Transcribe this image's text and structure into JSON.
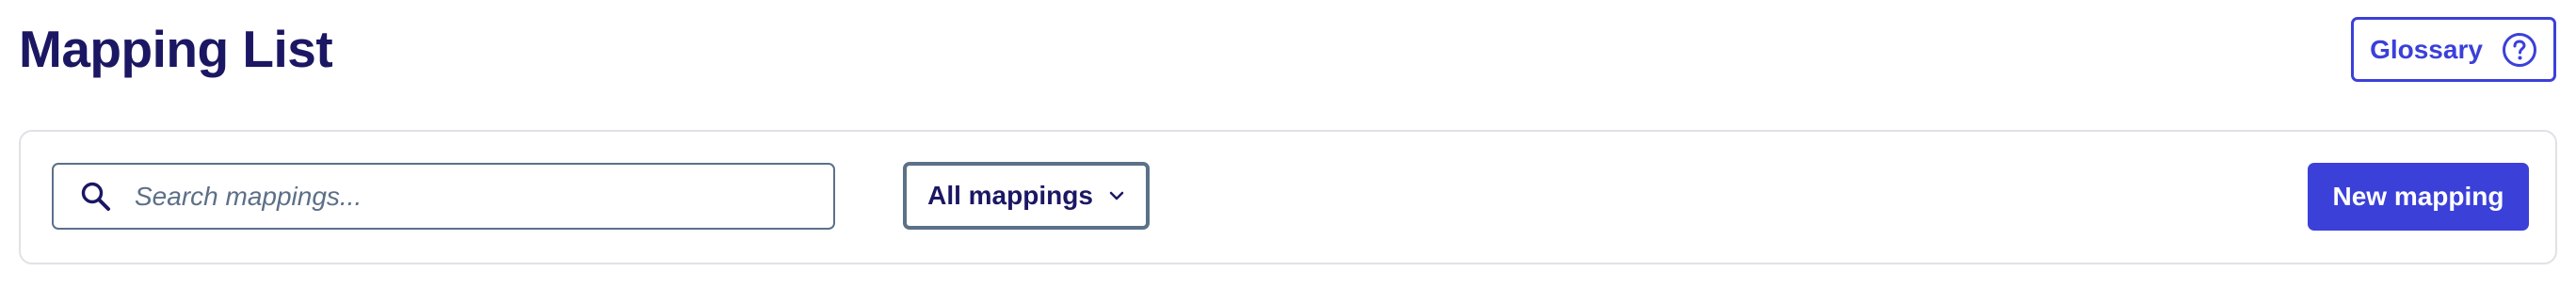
{
  "page": {
    "title": "Mapping List"
  },
  "header": {
    "glossary_label": "Glossary",
    "glossary_icon": "help-circle-icon"
  },
  "toolbar": {
    "search": {
      "placeholder": "Search mappings...",
      "value": "",
      "icon": "search-icon"
    },
    "filter": {
      "selected": "All mappings",
      "icon": "chevron-down-icon"
    },
    "new_mapping_label": "New mapping"
  },
  "colors": {
    "title": "#1b1763",
    "accent": "#3b40d9",
    "border": "#5b7188",
    "panel_border": "#e1e1e6"
  }
}
